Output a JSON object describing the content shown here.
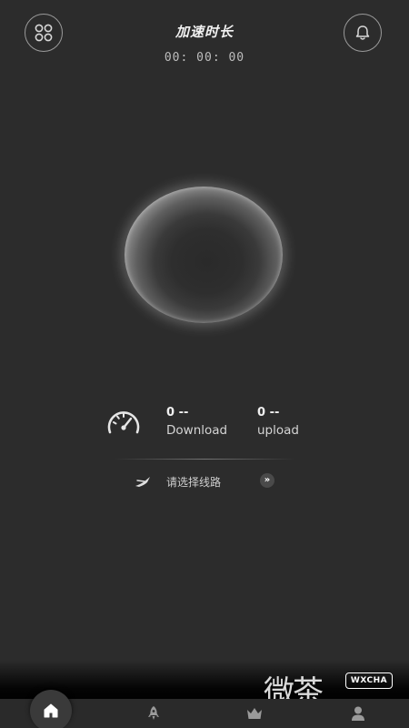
{
  "header": {
    "title": "加速时长",
    "timer": "00: 00: 00",
    "left_icon": "grid-icon",
    "right_icon": "bell-icon"
  },
  "stats": {
    "icon": "speedometer-icon",
    "download": {
      "value": "0 --",
      "label": "Download"
    },
    "upload": {
      "value": "0 --",
      "label": "upload"
    }
  },
  "route": {
    "icon": "route-icon",
    "text": "请选择线路",
    "arrow": "»"
  },
  "tabbar": {
    "items": [
      {
        "icon": "home-icon",
        "active": true
      },
      {
        "icon": "rocket-icon",
        "active": false
      },
      {
        "icon": "crown-icon",
        "active": false
      },
      {
        "icon": "user-icon",
        "active": false
      }
    ]
  },
  "watermark": {
    "chars": "微茶",
    "badge": "WXCHA"
  },
  "colors": {
    "background": "#2c2c2c",
    "ring_edge": "#ffffff",
    "text": "#e8e8e8"
  }
}
